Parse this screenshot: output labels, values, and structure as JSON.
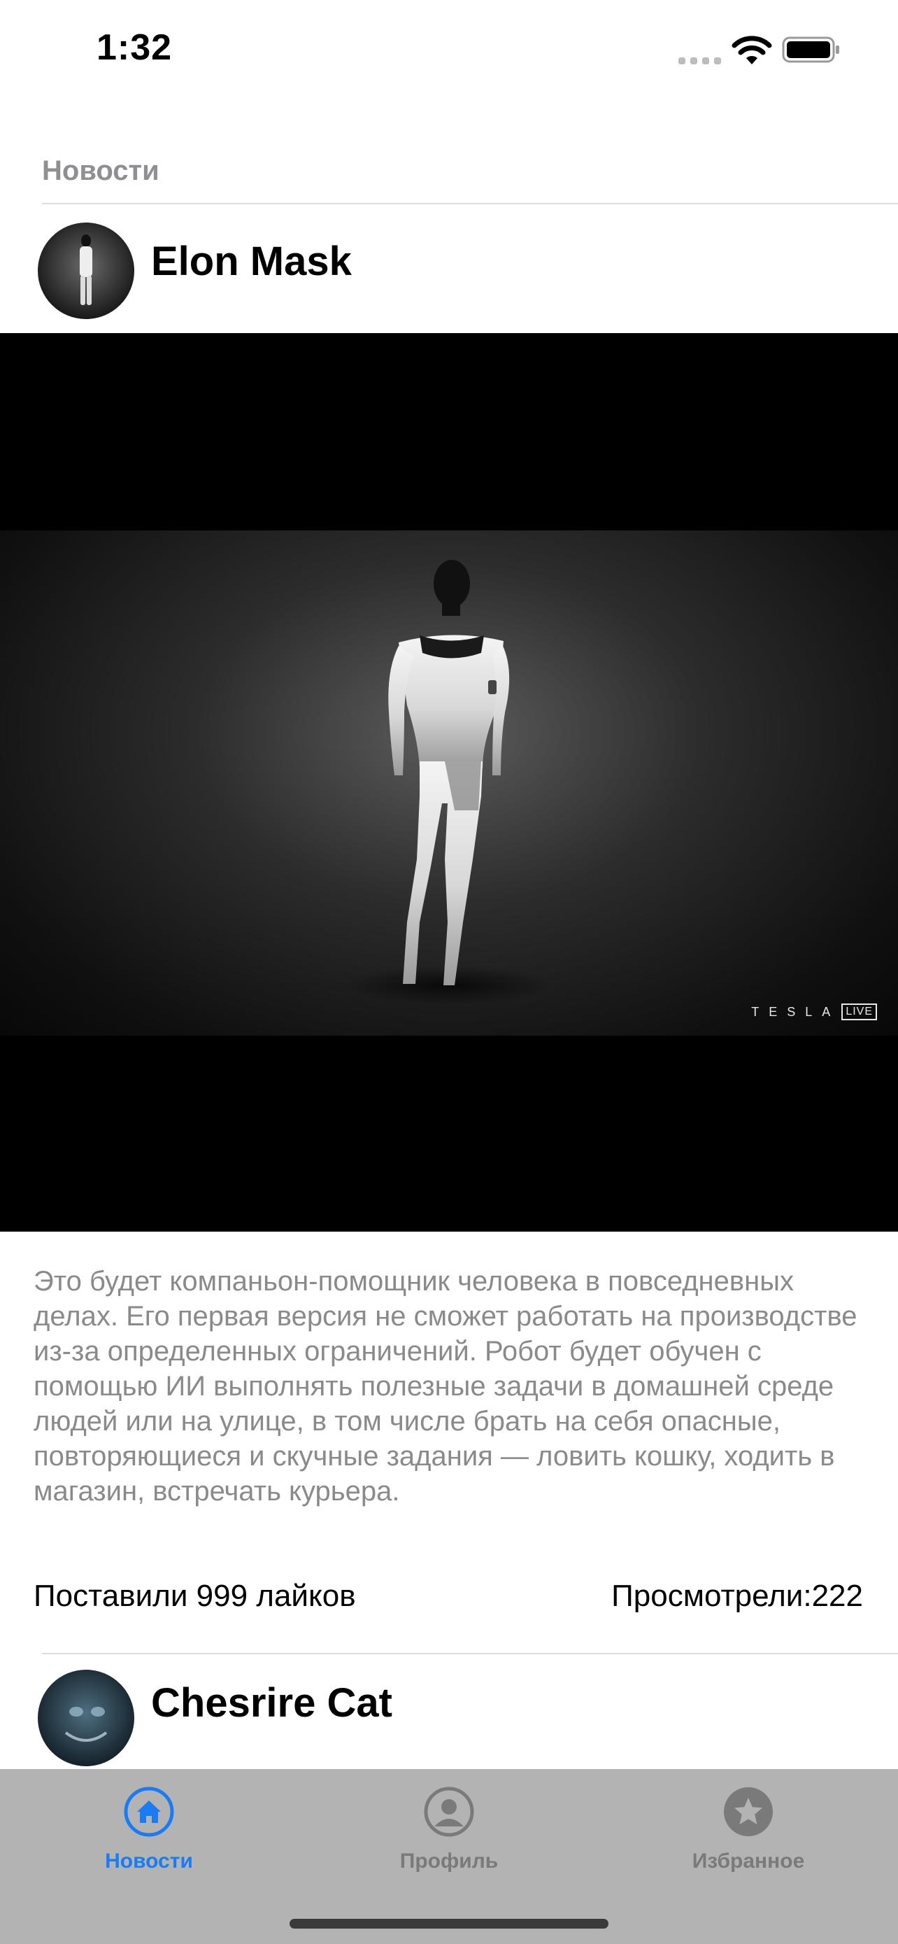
{
  "status_bar": {
    "time": "1:32"
  },
  "section": {
    "title": "Новости"
  },
  "posts": [
    {
      "author": "Elon Mask",
      "watermark": "TESLA",
      "watermark_badge": "LIVE",
      "text": "Это будет компаньон-помощник человека в повседневных делах. Его первая версия не сможет работать на производстве из-за определенных ограничений. Робот будет обучен с помощью ИИ выполнять полезные задачи в домашней среде людей или на улице, в том числе брать на себя опасные, повторяющиеся и скучные задания — ловить кошку, ходить в магазин, встречать курьера.",
      "likes": "Поставили 999 лайков",
      "views": "Просмотрели:222"
    },
    {
      "author": "Chesrire Cat"
    }
  ],
  "tabbar": {
    "active_color": "#1a7cf5",
    "inactive_color": "#7a7a7a",
    "items": [
      {
        "label": "Новости",
        "icon": "house-circle-icon",
        "active": true
      },
      {
        "label": "Профиль",
        "icon": "person-circle-icon",
        "active": false
      },
      {
        "label": "Избранное",
        "icon": "star-circle-icon",
        "active": false
      }
    ]
  }
}
